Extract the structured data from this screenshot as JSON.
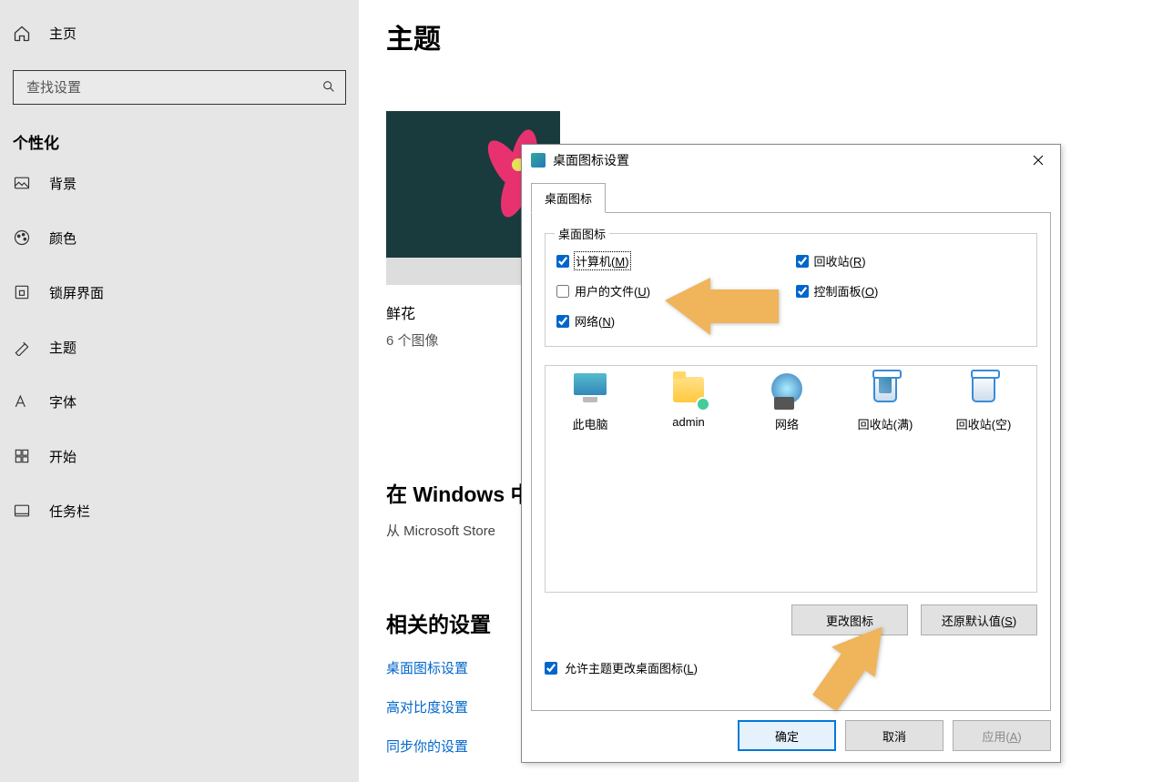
{
  "sidebar": {
    "home": "主页",
    "search_placeholder": "查找设置",
    "section": "个性化",
    "items": [
      {
        "label": "背景"
      },
      {
        "label": "颜色"
      },
      {
        "label": "锁屏界面"
      },
      {
        "label": "主题"
      },
      {
        "label": "字体"
      },
      {
        "label": "开始"
      },
      {
        "label": "任务栏"
      }
    ]
  },
  "main": {
    "title": "主题",
    "theme_name": "鲜花",
    "theme_sub": "6 个图像",
    "store_line": "在 Windows 中",
    "store_sub": "从 Microsoft Store ",
    "related_title": "相关的设置",
    "links": [
      "桌面图标设置",
      "高对比度设置",
      "同步你的设置"
    ]
  },
  "dialog": {
    "title": "桌面图标设置",
    "tab": "桌面图标",
    "group_label": "桌面图标",
    "checks": {
      "computer": {
        "pre": "计算机(",
        "u": "M",
        "post": ")",
        "checked": true,
        "focused": true
      },
      "recycle": {
        "pre": "回收站(",
        "u": "R",
        "post": ")",
        "checked": true
      },
      "userfiles": {
        "pre": "用户的文件(",
        "u": "U",
        "post": ")",
        "checked": false
      },
      "ctrlpanel": {
        "pre": "控制面板(",
        "u": "O",
        "post": ")",
        "checked": true
      },
      "network": {
        "pre": "网络(",
        "u": "N",
        "post": ")",
        "checked": true
      }
    },
    "previews": [
      {
        "label": "此电脑"
      },
      {
        "label": "admin"
      },
      {
        "label": "网络"
      },
      {
        "label": "回收站(满)"
      },
      {
        "label": "回收站(空)"
      }
    ],
    "btn_change_pre": "更改图标",
    "btn_restore_pre": "还原默认值(",
    "btn_restore_u": "S",
    "btn_restore_post": ")",
    "allow_theme": {
      "pre": "允许主题更改桌面图标(",
      "u": "L",
      "post": ")",
      "checked": true
    },
    "ok": "确定",
    "cancel": "取消",
    "apply_pre": "应用(",
    "apply_u": "A",
    "apply_post": ")"
  }
}
